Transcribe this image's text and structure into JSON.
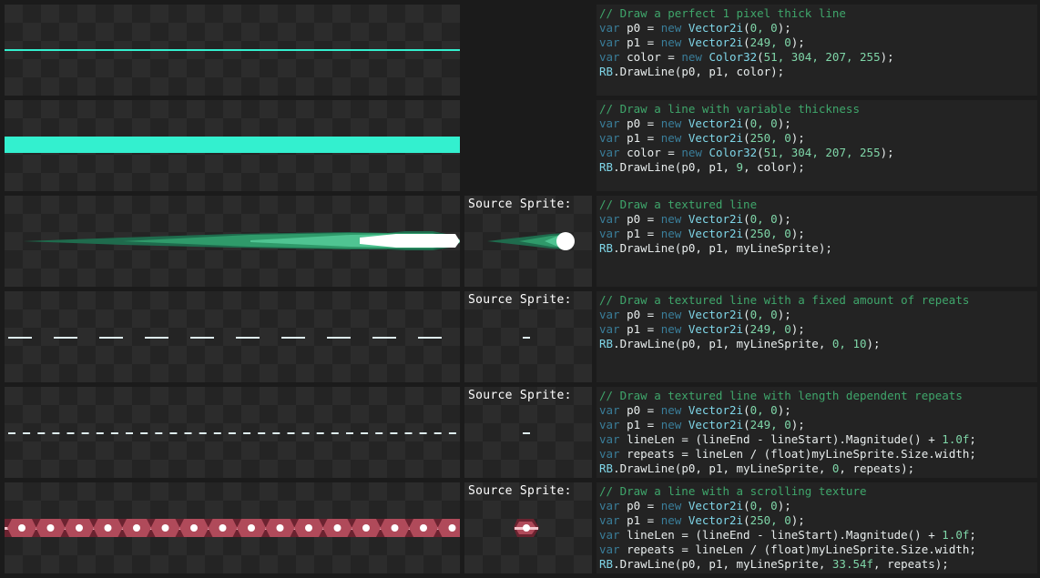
{
  "labels": {
    "source_sprite": "Source Sprite:"
  },
  "colors": {
    "line": "#33f0cf",
    "textured_green": "#3fb47d",
    "scroll_red": "#b04a5a"
  },
  "rows": [
    {
      "code": [
        [
          [
            "c",
            "// Draw a perfect 1 pixel thick line"
          ]
        ],
        [
          [
            "k",
            "var "
          ],
          [
            "w",
            "p0 = "
          ],
          [
            "k",
            "new "
          ],
          [
            "t",
            "Vector2i"
          ],
          [
            "w",
            "("
          ],
          [
            "n",
            "0, 0"
          ],
          [
            "w",
            ");"
          ]
        ],
        [
          [
            "k",
            "var "
          ],
          [
            "w",
            "p1 = "
          ],
          [
            "k",
            "new "
          ],
          [
            "t",
            "Vector2i"
          ],
          [
            "w",
            "("
          ],
          [
            "n",
            "249, 0"
          ],
          [
            "w",
            ");"
          ]
        ],
        [
          [
            "k",
            "var "
          ],
          [
            "w",
            "color = "
          ],
          [
            "k",
            "new "
          ],
          [
            "t",
            "Color32"
          ],
          [
            "w",
            "("
          ],
          [
            "n",
            "51, 304, 207, 255"
          ],
          [
            "w",
            ");"
          ]
        ],
        [
          [
            "t",
            "RB"
          ],
          [
            "w",
            ".DrawLine(p0, p1, color);"
          ]
        ]
      ]
    },
    {
      "code": [
        [
          [
            "c",
            "// Draw a line with variable thickness"
          ]
        ],
        [
          [
            "k",
            "var "
          ],
          [
            "w",
            "p0 = "
          ],
          [
            "k",
            "new "
          ],
          [
            "t",
            "Vector2i"
          ],
          [
            "w",
            "("
          ],
          [
            "n",
            "0, 0"
          ],
          [
            "w",
            ");"
          ]
        ],
        [
          [
            "k",
            "var "
          ],
          [
            "w",
            "p1 = "
          ],
          [
            "k",
            "new "
          ],
          [
            "t",
            "Vector2i"
          ],
          [
            "w",
            "("
          ],
          [
            "n",
            "250, 0"
          ],
          [
            "w",
            ");"
          ]
        ],
        [
          [
            "k",
            "var "
          ],
          [
            "w",
            "color = "
          ],
          [
            "k",
            "new "
          ],
          [
            "t",
            "Color32"
          ],
          [
            "w",
            "("
          ],
          [
            "n",
            "51, 304, 207, 255"
          ],
          [
            "w",
            ");"
          ]
        ],
        [
          [
            "t",
            "RB"
          ],
          [
            "w",
            ".DrawLine(p0, p1, "
          ],
          [
            "n",
            "9"
          ],
          [
            "w",
            ", color);"
          ]
        ]
      ]
    },
    {
      "code": [
        [
          [
            "c",
            "// Draw a textured line"
          ]
        ],
        [
          [
            "k",
            "var "
          ],
          [
            "w",
            "p0 = "
          ],
          [
            "k",
            "new "
          ],
          [
            "t",
            "Vector2i"
          ],
          [
            "w",
            "("
          ],
          [
            "n",
            "0, 0"
          ],
          [
            "w",
            ");"
          ]
        ],
        [
          [
            "k",
            "var "
          ],
          [
            "w",
            "p1 = "
          ],
          [
            "k",
            "new "
          ],
          [
            "t",
            "Vector2i"
          ],
          [
            "w",
            "("
          ],
          [
            "n",
            "250, 0"
          ],
          [
            "w",
            ");"
          ]
        ],
        [
          [
            "t",
            "RB"
          ],
          [
            "w",
            ".DrawLine(p0, p1, myLineSprite);"
          ]
        ]
      ]
    },
    {
      "code": [
        [
          [
            "c",
            "// Draw a textured line with a fixed amount of repeats"
          ]
        ],
        [
          [
            "k",
            "var "
          ],
          [
            "w",
            "p0 = "
          ],
          [
            "k",
            "new "
          ],
          [
            "t",
            "Vector2i"
          ],
          [
            "w",
            "("
          ],
          [
            "n",
            "0, 0"
          ],
          [
            "w",
            ");"
          ]
        ],
        [
          [
            "k",
            "var "
          ],
          [
            "w",
            "p1 = "
          ],
          [
            "k",
            "new "
          ],
          [
            "t",
            "Vector2i"
          ],
          [
            "w",
            "("
          ],
          [
            "n",
            "249, 0"
          ],
          [
            "w",
            ");"
          ]
        ],
        [
          [
            "t",
            "RB"
          ],
          [
            "w",
            ".DrawLine(p0, p1, myLineSprite, "
          ],
          [
            "n",
            "0, 10"
          ],
          [
            "w",
            ");"
          ]
        ]
      ]
    },
    {
      "code": [
        [
          [
            "c",
            "// Draw a textured line with length dependent repeats"
          ]
        ],
        [
          [
            "k",
            "var "
          ],
          [
            "w",
            "p0 = "
          ],
          [
            "k",
            "new "
          ],
          [
            "t",
            "Vector2i"
          ],
          [
            "w",
            "("
          ],
          [
            "n",
            "0, 0"
          ],
          [
            "w",
            ");"
          ]
        ],
        [
          [
            "k",
            "var "
          ],
          [
            "w",
            "p1 = "
          ],
          [
            "k",
            "new "
          ],
          [
            "t",
            "Vector2i"
          ],
          [
            "w",
            "("
          ],
          [
            "n",
            "249, 0"
          ],
          [
            "w",
            ");"
          ]
        ],
        [
          [
            "k",
            "var "
          ],
          [
            "w",
            "lineLen = (lineEnd - lineStart).Magnitude() + "
          ],
          [
            "n",
            "1.0f"
          ],
          [
            "w",
            ";"
          ]
        ],
        [
          [
            "k",
            "var "
          ],
          [
            "w",
            "repeats = lineLen / (float)myLineSprite.Size.width;"
          ]
        ],
        [
          [
            "t",
            "RB"
          ],
          [
            "w",
            ".DrawLine(p0, p1, myLineSprite, "
          ],
          [
            "n",
            "0"
          ],
          [
            "w",
            ", repeats);"
          ]
        ]
      ]
    },
    {
      "code": [
        [
          [
            "c",
            "// Draw a line with a scrolling texture"
          ]
        ],
        [
          [
            "k",
            "var "
          ],
          [
            "w",
            "p0 = "
          ],
          [
            "k",
            "new "
          ],
          [
            "t",
            "Vector2i"
          ],
          [
            "w",
            "("
          ],
          [
            "n",
            "0, 0"
          ],
          [
            "w",
            ");"
          ]
        ],
        [
          [
            "k",
            "var "
          ],
          [
            "w",
            "p1 = "
          ],
          [
            "k",
            "new "
          ],
          [
            "t",
            "Vector2i"
          ],
          [
            "w",
            "("
          ],
          [
            "n",
            "250, 0"
          ],
          [
            "w",
            ");"
          ]
        ],
        [
          [
            "k",
            "var "
          ],
          [
            "w",
            "lineLen = (lineEnd - lineStart).Magnitude() + "
          ],
          [
            "n",
            "1.0f"
          ],
          [
            "w",
            ";"
          ]
        ],
        [
          [
            "k",
            "var "
          ],
          [
            "w",
            "repeats = lineLen / (float)myLineSprite.Size.width;"
          ]
        ],
        [
          [
            "t",
            "RB"
          ],
          [
            "w",
            ".DrawLine(p0, p1, myLineSprite, "
          ],
          [
            "n",
            "33.54f"
          ],
          [
            "w",
            ", repeats);"
          ]
        ]
      ]
    }
  ]
}
